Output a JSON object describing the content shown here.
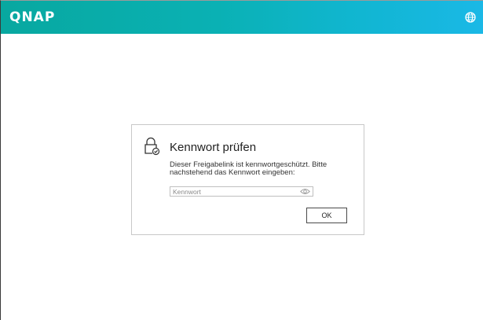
{
  "header": {
    "logo_text": "QNAP",
    "language_icon": "globe-icon",
    "background_colors": [
      "#08a8a0",
      "#1ab8e6"
    ]
  },
  "dialog": {
    "icon": "lock-check-icon",
    "title": "Kennwort prüfen",
    "description": "Dieser Freigabelink ist kennwortgeschützt. Bitte nachstehend das Kennwort eingeben:",
    "password": {
      "placeholder": "Kennwort",
      "value": "",
      "toggle_icon": "eye-icon"
    },
    "ok_label": "OK"
  }
}
